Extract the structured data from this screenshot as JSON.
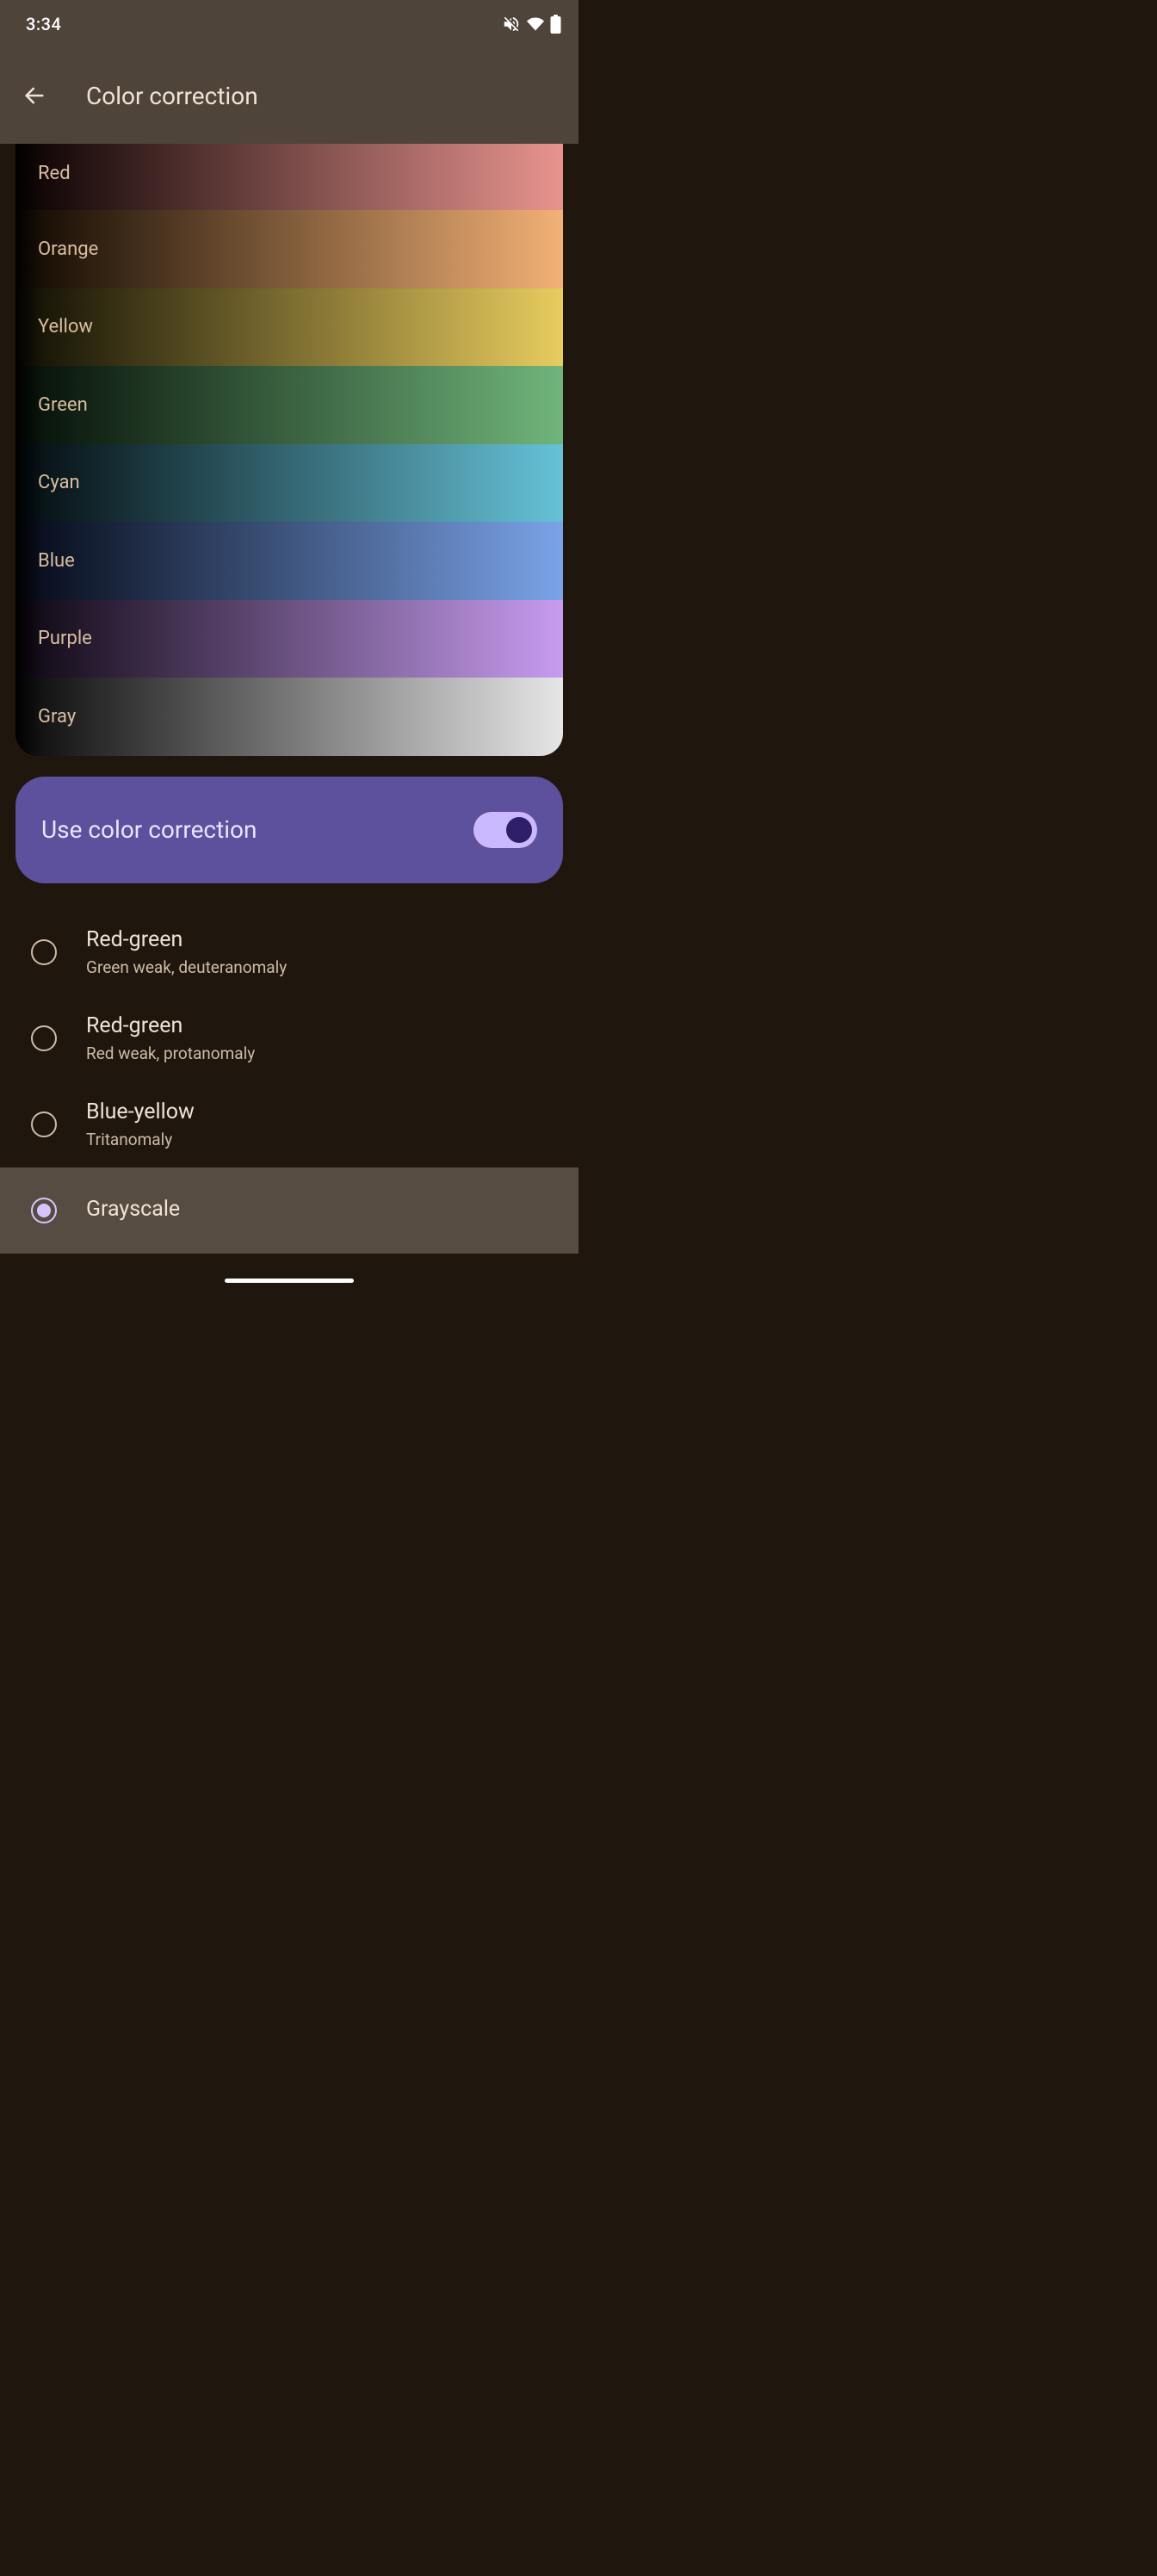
{
  "status": {
    "time": "3:34"
  },
  "appbar": {
    "title": "Color correction"
  },
  "preview": {
    "rows": [
      {
        "label": "Red"
      },
      {
        "label": "Orange"
      },
      {
        "label": "Yellow"
      },
      {
        "label": "Green"
      },
      {
        "label": "Cyan"
      },
      {
        "label": "Blue"
      },
      {
        "label": "Purple"
      },
      {
        "label": "Gray"
      }
    ]
  },
  "toggle": {
    "label": "Use color correction",
    "value": true,
    "accent": "#5d509c"
  },
  "options": [
    {
      "title": "Red-green",
      "subtitle": "Green weak, deuteranomaly",
      "selected": false
    },
    {
      "title": "Red-green",
      "subtitle": "Red weak, protanomaly",
      "selected": false
    },
    {
      "title": "Blue-yellow",
      "subtitle": "Tritanomaly",
      "selected": false
    },
    {
      "title": "Grayscale",
      "subtitle": "",
      "selected": true
    }
  ]
}
